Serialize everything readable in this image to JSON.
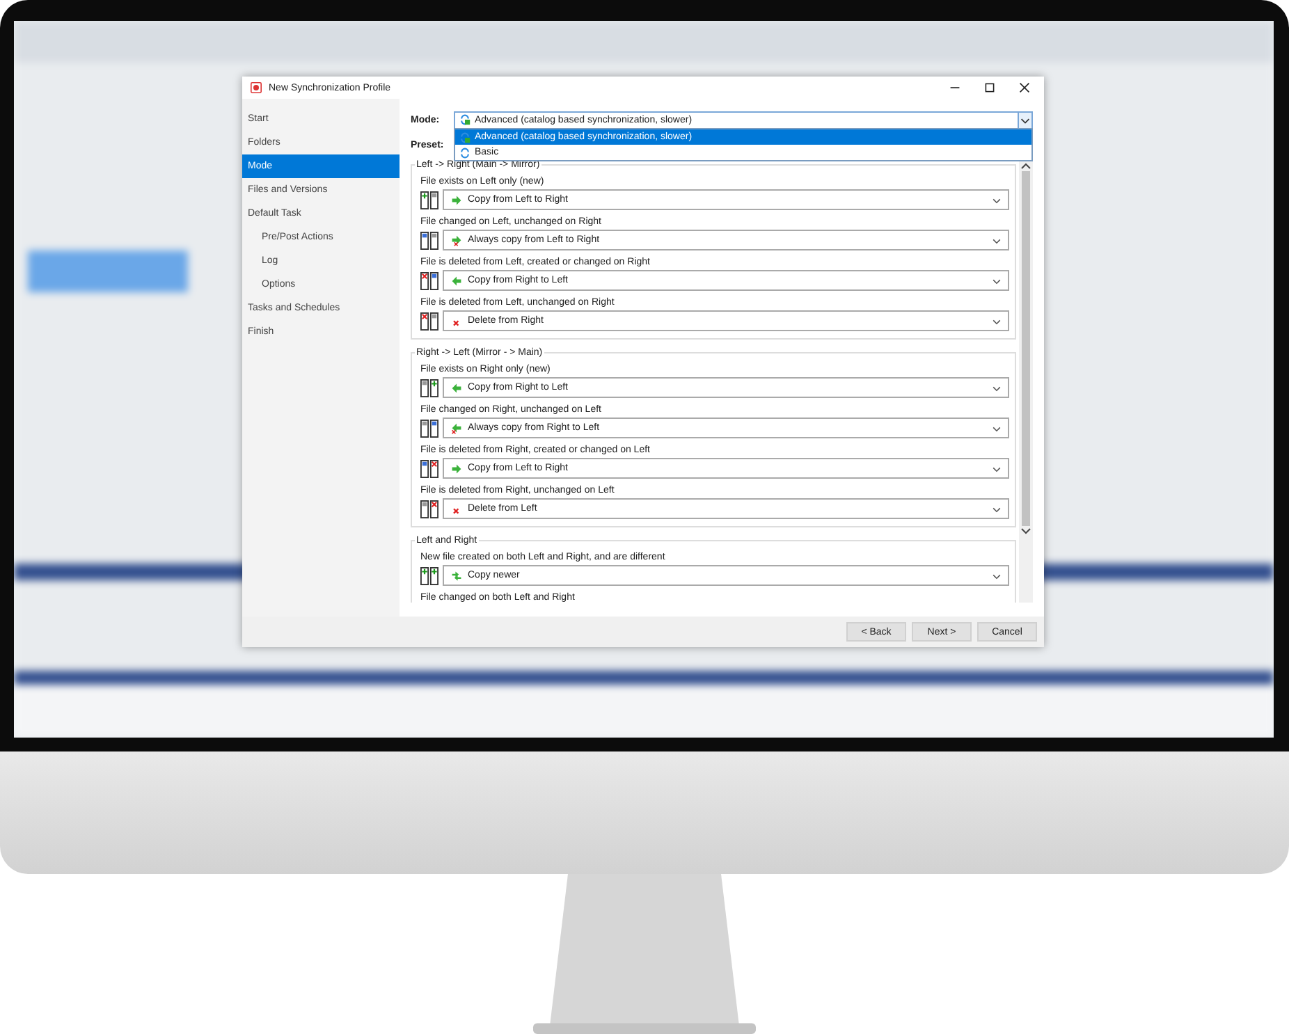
{
  "window": {
    "title": "New Synchronization Profile"
  },
  "sidebar": {
    "items": [
      {
        "label": "Start",
        "selected": false
      },
      {
        "label": "Folders",
        "selected": false
      },
      {
        "label": "Mode",
        "selected": true
      },
      {
        "label": "Files and Versions",
        "selected": false
      },
      {
        "label": "Default Task",
        "selected": false,
        "children": [
          {
            "label": "Pre/Post Actions",
            "selected": false
          },
          {
            "label": "Log",
            "selected": false
          },
          {
            "label": "Options",
            "selected": false
          }
        ]
      },
      {
        "label": "Tasks and Schedules",
        "selected": false
      },
      {
        "label": "Finish",
        "selected": false
      }
    ]
  },
  "mode": {
    "label": "Mode:",
    "value": "Advanced (catalog based synchronization, slower)",
    "kind": "advanced",
    "options": [
      {
        "label": "Advanced (catalog based synchronization, slower)",
        "kind": "advanced",
        "selected": true
      },
      {
        "label": "Basic",
        "kind": "basic",
        "selected": false
      }
    ]
  },
  "preset": {
    "label": "Preset:"
  },
  "groups": [
    {
      "title": "Left -> Right (Main -> Mirror)",
      "rules": [
        {
          "condition": "File exists on Left only (new)",
          "kind": "left-new",
          "action": {
            "label": "Copy from Left to Right",
            "kind": "right"
          }
        },
        {
          "condition": "File changed on Left, unchanged on Right",
          "kind": "left-changed",
          "action": {
            "label": "Always copy from Left to Right",
            "kind": "alwaysright"
          }
        },
        {
          "condition": "File is deleted from Left, created or changed on Right",
          "kind": "left-deleted-right-changed",
          "action": {
            "label": "Copy from Right to Left",
            "kind": "left"
          }
        },
        {
          "condition": "File is deleted from Left, unchanged on Right",
          "kind": "left-deleted",
          "action": {
            "label": "Delete from Right",
            "kind": "delete"
          }
        }
      ]
    },
    {
      "title": "Right -> Left (Mirror - > Main)",
      "rules": [
        {
          "condition": "File exists on Right only (new)",
          "kind": "right-new",
          "action": {
            "label": "Copy from Right to Left",
            "kind": "left"
          }
        },
        {
          "condition": "File changed on Right, unchanged on Left",
          "kind": "right-changed",
          "action": {
            "label": "Always copy from Right to Left",
            "kind": "alwaysleft"
          }
        },
        {
          "condition": "File is deleted from Right, created or changed on Left",
          "kind": "right-deleted-left-changed",
          "action": {
            "label": "Copy from Left to Right",
            "kind": "right"
          }
        },
        {
          "condition": "File is deleted from Right, unchanged on Left",
          "kind": "right-deleted",
          "action": {
            "label": "Delete from Left",
            "kind": "delete"
          }
        }
      ]
    },
    {
      "title": "Left and Right",
      "rules": [
        {
          "condition": "New file created on both Left and Right, and are different",
          "kind": "both-new",
          "action": {
            "label": "Copy newer",
            "kind": "newer"
          }
        },
        {
          "condition": "File changed on both Left and Right"
        }
      ]
    }
  ],
  "buttons": [
    "< Back",
    "Next >",
    "Cancel"
  ]
}
